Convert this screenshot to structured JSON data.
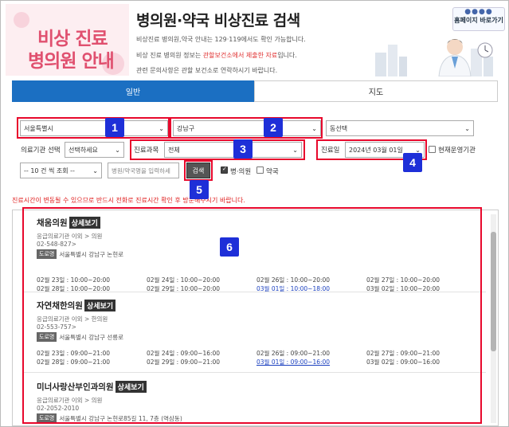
{
  "header": {
    "left_title_line1": "비상 진료",
    "left_title_line2": "병의원 안내",
    "title": "병의원·약국 비상진료 검색",
    "line1": "비상진료 병의원,약국 안내는 129·119에서도 확인 가능합니다.",
    "line2_pre": "비상 진료 병의원 정보는 ",
    "line2_red": "관할보건소에서 제출한 자료",
    "line2_post": "입니다.",
    "line3": "관련 문의사항은 관할 보건소로 연락하시기 바랍니다.",
    "home_label": "홈페이지 바로가기"
  },
  "tabs": [
    {
      "label": "일반",
      "active": true
    },
    {
      "label": "지도",
      "active": false
    }
  ],
  "form": {
    "sido": "서울특별시",
    "sigungu": "강남구",
    "dong": "동선택",
    "inst_label": "의료기관 선택",
    "inst_value": "선택하세요",
    "dept_label": "진료과목",
    "dept_value": "전체",
    "date_label": "진료일",
    "date_value": "2024년 03월 01일",
    "open_now_label": "현재운영기관",
    "page_size": "-- 10 건 씩 조회 --",
    "name_placeholder": "병원/약국명을 입력하세",
    "search_label": "검색",
    "hospital_label": "병·의원",
    "pharmacy_label": "약국"
  },
  "notice": "진료시간이 변동될 수 있으므로 반드시 전화로 진료시간 확인 후 방문해주시기 바랍니다.",
  "badges": [
    "1",
    "2",
    "3",
    "4",
    "5",
    "6"
  ],
  "detail_label": "상세보기",
  "road_tag": "도로명",
  "results": [
    {
      "name": "채움의원",
      "category": "응급의료기관 이외 > 의원",
      "phone": "02-548-827>",
      "address": "서울특별시 강남구 논현로",
      "schedule": [
        "02월 23일 : 10:00~20:00",
        "02월 24일 : 10:00~20:00",
        "02월 26일 : 10:00~20:00",
        "02월 27일 : 10:00~20:00",
        "02월 28일 : 10:00~20:00",
        "02월 29일 : 10:00~20:00",
        "03월 01일 : 10:00~18:00",
        "03월 02일 : 10:00~20:00"
      ]
    },
    {
      "name": "자연채한의원",
      "category": "응급의료기관 이외 > 한의원",
      "phone": "02-553-757>",
      "address": "서울특별시 강남구 선릉로",
      "schedule": [
        "02월 23일 : 09:00~21:00",
        "02월 24일 : 09:00~16:00",
        "02월 26일 : 09:00~21:00",
        "02월 27일 : 09:00~21:00",
        "02월 28일 : 09:00~21:00",
        "02월 29일 : 09:00~21:00",
        "03월 01일 : 09:00~16:00",
        "03월 02일 : 09:00~16:00"
      ]
    },
    {
      "name": "미너사랑산부인과의원",
      "category": "응급의료기관 이외 > 의원",
      "phone": "02-2052-2010",
      "address": "서울특별시 강남구 논현로85길 11, 7층 (역삼동)"
    }
  ],
  "colors": {
    "tab_active": "#1b6fc2",
    "marker_red": "#e8082c",
    "badge_blue": "#1e2fd8",
    "brand_pink": "#e0506f",
    "link_blue": "#1a3fbf"
  }
}
